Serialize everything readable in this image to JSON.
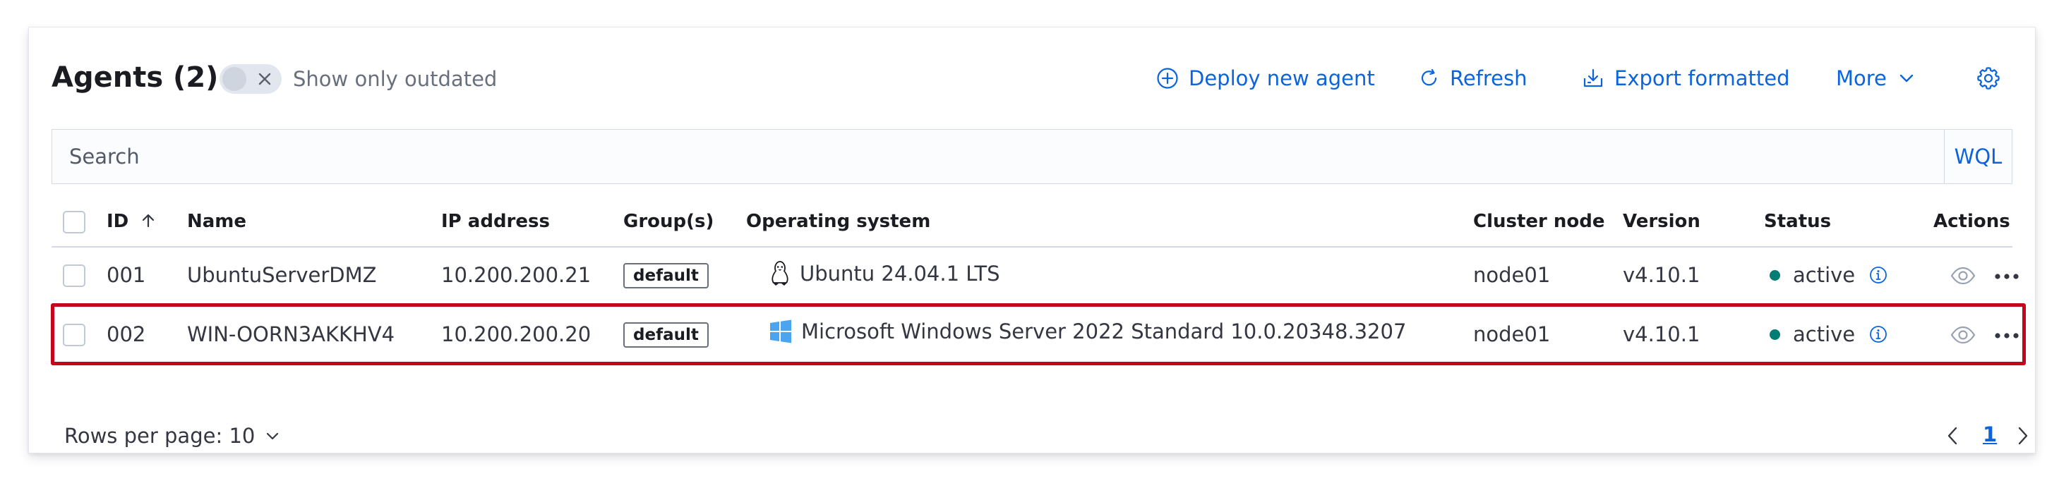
{
  "header": {
    "title": "Agents (2)",
    "outdated_toggle_label": "Show only outdated",
    "deploy_label": "Deploy new agent",
    "refresh_label": "Refresh",
    "export_label": "Export formatted",
    "more_label": "More"
  },
  "search": {
    "placeholder": "Search",
    "wql_label": "WQL"
  },
  "table": {
    "columns": {
      "id": "ID",
      "name": "Name",
      "ip": "IP address",
      "groups": "Group(s)",
      "os": "Operating system",
      "cluster": "Cluster node",
      "version": "Version",
      "status": "Status",
      "actions": "Actions"
    },
    "rows": [
      {
        "id": "001",
        "name": "UbuntuServerDMZ",
        "ip": "10.200.200.21",
        "group": "default",
        "os": "Ubuntu 24.04.1 LTS",
        "os_icon": "linux-tux-icon",
        "cluster": "node01",
        "version": "v4.10.1",
        "status": "active"
      },
      {
        "id": "002",
        "name": "WIN-OORN3AKKHV4",
        "ip": "10.200.200.20",
        "group": "default",
        "os": "Microsoft Windows Server 2022 Standard 10.0.20348.3207",
        "os_icon": "windows-logo-icon",
        "cluster": "node01",
        "version": "v4.10.1",
        "status": "active"
      }
    ]
  },
  "footer": {
    "rows_per_page": "Rows per page: 10",
    "current_page": "1"
  },
  "colors": {
    "accent": "#0b64dd",
    "status_active": "#017d73",
    "highlight": "#c6051c"
  }
}
